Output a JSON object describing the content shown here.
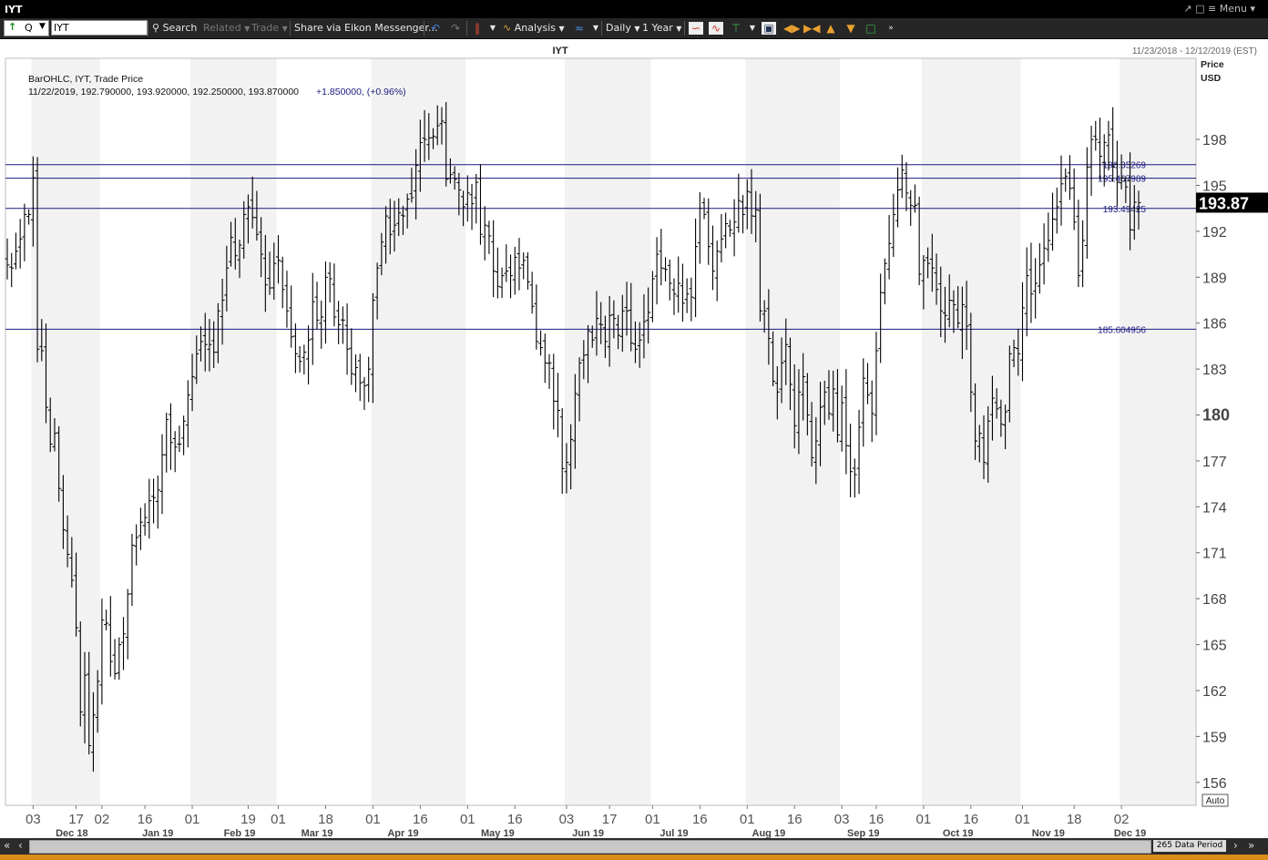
{
  "window": {
    "title": "IYT",
    "menu_label": "Menu"
  },
  "toolbar": {
    "quote_label": "Q",
    "ric_value": "IYT",
    "search_label": "Search",
    "related_label": "Related",
    "trade_label": "Trade",
    "share_label": "Share via Eikon Messenger...",
    "analysis_label": "Analysis",
    "interval_label": "Daily",
    "range_label": "1 Year"
  },
  "chart_header": {
    "symbol": "IYT",
    "date_range": "11/23/2018 - 12/12/2019 (EST)",
    "legend_line1": "BarOHLC, IYT, Trade Price",
    "legend_line2a": "11/22/2019, 192.790000, 193.920000, 192.250000, 193.870000",
    "legend_line2b": "+1.850000, (+0.96%)",
    "price_label": "Price",
    "currency_label": "USD"
  },
  "bottom": {
    "data_period": "265 Data Period",
    "auto_label": "Auto"
  },
  "colors": {
    "bar": "#000000",
    "hline": "#1a1a80",
    "last_price_bg": "#000000",
    "accent": "#d98c1a"
  },
  "chart_data": {
    "type": "ohlc",
    "title": "IYT",
    "ylim": [
      154.5,
      203.3
    ],
    "ytick_values": [
      156,
      159,
      162,
      165,
      168,
      171,
      174,
      177,
      180,
      183,
      186,
      189,
      192,
      195,
      198
    ],
    "ytick_labels": [
      "156",
      "159",
      "162",
      "165",
      "168",
      "171",
      "174",
      "177",
      "180",
      "183",
      "186",
      "189",
      "192",
      "195",
      "198"
    ],
    "ytick_bold": "180",
    "last_price": "193.87",
    "last_value": 193.87,
    "horizontal_lines": [
      {
        "value": 196.35269,
        "label": "196.35269"
      },
      {
        "value": 195.467989,
        "label": "195.467989"
      },
      {
        "value": 193.49425,
        "label": "193.49425"
      },
      {
        "value": 185.604956,
        "label": "185.604956"
      }
    ],
    "xtick_days": [
      "03",
      "17",
      "02",
      "16",
      "01",
      "19",
      "01",
      "18",
      "01",
      "16",
      "01",
      "16",
      "03",
      "17",
      "01",
      "16",
      "01",
      "16",
      "03",
      "16",
      "01",
      "16",
      "01",
      "18",
      "02"
    ],
    "xtick_days_index": [
      6,
      16,
      22,
      32,
      43,
      56,
      63,
      74,
      85,
      96,
      107,
      118,
      130,
      140,
      150,
      161,
      172,
      183,
      194,
      202,
      213,
      224,
      236,
      248,
      259
    ],
    "month_labels": [
      "Dec 18",
      "Jan 19",
      "Feb 19",
      "Mar 19",
      "Apr 19",
      "May 19",
      "Jun 19",
      "Jul 19",
      "Aug 19",
      "Sep 19",
      "Oct 19",
      "Nov 19",
      "Dec 19"
    ],
    "month_index": [
      15,
      35,
      54,
      72,
      92,
      114,
      135,
      155,
      177,
      199,
      221,
      242,
      261
    ],
    "closes": [
      189.8,
      189.6,
      190.7,
      191.5,
      193.1,
      193.1,
      195.5,
      184.3,
      184.2,
      180.5,
      178.1,
      178.8,
      175.2,
      172.5,
      170.9,
      169.2,
      166.1,
      160.6,
      163.0,
      158.4,
      160.4,
      162.6,
      166.6,
      166.4,
      163.9,
      163.1,
      165.0,
      165.7,
      168.3,
      171.5,
      172.0,
      173.0,
      173.3,
      174.4,
      174.6,
      175.1,
      177.4,
      179.7,
      178.2,
      177.9,
      178.1,
      179.6,
      181.3,
      182.5,
      184.0,
      184.8,
      184.6,
      184.6,
      184.1,
      186.8,
      187.5,
      189.6,
      191.6,
      190.4,
      191.1,
      193.1,
      193.6,
      192.9,
      191.8,
      190.5,
      188.5,
      188.3,
      189.9,
      190.1,
      188.2,
      186.8,
      185.1,
      184.0,
      183.5,
      184.1,
      184.9,
      187.4,
      186.2,
      186.4,
      189.0,
      188.9,
      186.4,
      185.9,
      186.2,
      184.3,
      182.7,
      183.1,
      182.1,
      181.9,
      183.0,
      187.5,
      189.6,
      191.3,
      193.0,
      191.8,
      192.4,
      193.2,
      193.0,
      194.1,
      194.2,
      196.3,
      197.8,
      198.0,
      198.1,
      198.2,
      198.9,
      199.2,
      195.4,
      195.7,
      195.4,
      194.7,
      193.6,
      194.5,
      193.8,
      195.2,
      191.8,
      192.4,
      191.7,
      189.4,
      188.4,
      189.1,
      189.4,
      189.1,
      190.3,
      189.6,
      190.1,
      188.7,
      187.1,
      184.8,
      184.4,
      183.4,
      183.4,
      180.9,
      180.3,
      176.5,
      176.9,
      178.4,
      181.4,
      183.4,
      183.9,
      185.5,
      184.9,
      186.3,
      185.9,
      184.8,
      186.5,
      186.3,
      185.2,
      186.8,
      186.8,
      184.7,
      184.3,
      184.9,
      186.1,
      186.7,
      188.9,
      190.5,
      189.6,
      189.5,
      188.6,
      187.9,
      188.6,
      187.3,
      187.9,
      187.7,
      191.0,
      193.5,
      193.1,
      191.0,
      189.4,
      190.7,
      191.5,
      192.5,
      192.1,
      192.6,
      194.0,
      193.1,
      194.6,
      193.0,
      193.4,
      186.8,
      186.8,
      185.0,
      182.2,
      181.5,
      183.4,
      184.6,
      182.0,
      179.3,
      181.5,
      182.5,
      180.0,
      177.2,
      178.3,
      180.5,
      181.5,
      180.1,
      181.7,
      178.7,
      180.8,
      178.0,
      176.3,
      176.1,
      179.2,
      182.4,
      181.3,
      180.1,
      184.2,
      188.0,
      189.9,
      191.2,
      193.1,
      194.7,
      196.0,
      194.5,
      193.7,
      193.7,
      189.2,
      190.1,
      189.9,
      189.6,
      188.2,
      186.8,
      186.5,
      187.5,
      187.2,
      186.0,
      187.2,
      185.8,
      181.5,
      178.3,
      178.8,
      176.9,
      179.6,
      181.1,
      180.4,
      179.4,
      180.2,
      184.0,
      184.4,
      184.0,
      187.0,
      189.1,
      187.9,
      188.6,
      189.8,
      190.9,
      191.4,
      192.8,
      193.6,
      195.1,
      195.6,
      194.8,
      192.6,
      189.1,
      191.4,
      196.2,
      198.0,
      198.0,
      196.9,
      197.8,
      198.3,
      196.2,
      195.2,
      195.5,
      194.9,
      192.1,
      193.9,
      193.87
    ]
  }
}
